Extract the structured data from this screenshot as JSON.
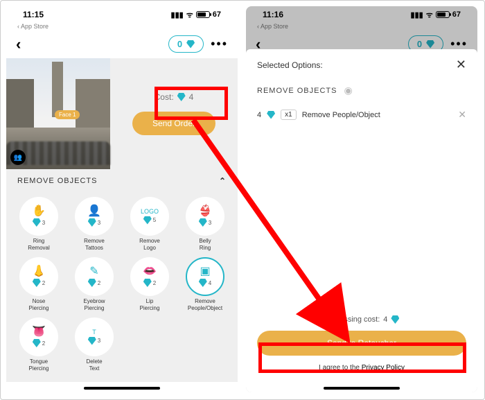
{
  "status": {
    "time_left": "11:15",
    "time_right": "11:16",
    "battery": "67",
    "sub": "App Store"
  },
  "header": {
    "credits": "0"
  },
  "hero": {
    "cost_label": "Cost:",
    "cost_value": "4",
    "face_tag": "Face 1",
    "send_label": "Send Order"
  },
  "section": {
    "title": "REMOVE OBJECTS"
  },
  "options": [
    {
      "icon": "✋",
      "price": "3",
      "label": "Ring\nRemoval"
    },
    {
      "icon": "👤",
      "price": "3",
      "label": "Remove\nTattoos"
    },
    {
      "icon": "LOGO",
      "price": "5",
      "label": "Remove\nLogo",
      "text_icon": true
    },
    {
      "icon": "👙",
      "price": "3",
      "label": "Belly\nRing"
    },
    {
      "icon": "👃",
      "price": "2",
      "label": "Nose\nPiercing"
    },
    {
      "icon": "✎",
      "price": "2",
      "label": "Eyebrow\nPiercing"
    },
    {
      "icon": "👄",
      "price": "2",
      "label": "Lip\nPiercing"
    },
    {
      "icon": "▣",
      "price": "4",
      "label": "Remove\nPeople/Object",
      "selected": true
    },
    {
      "icon": "👅",
      "price": "2",
      "label": "Tongue\nPiercing"
    },
    {
      "icon": "T",
      "price": "3",
      "label": "Delete\nText",
      "text_icon": true
    }
  ],
  "sheet": {
    "title": "Selected Options:",
    "group": "REMOVE OBJECTS",
    "item": {
      "price": "4",
      "qty": "x1",
      "name": "Remove People/Object"
    },
    "processing_label": "Processing cost:",
    "processing_value": "4",
    "cta": "Send to Retoucher",
    "agree_prefix": "I agree to the ",
    "agree_link": "Privacy Policy"
  }
}
